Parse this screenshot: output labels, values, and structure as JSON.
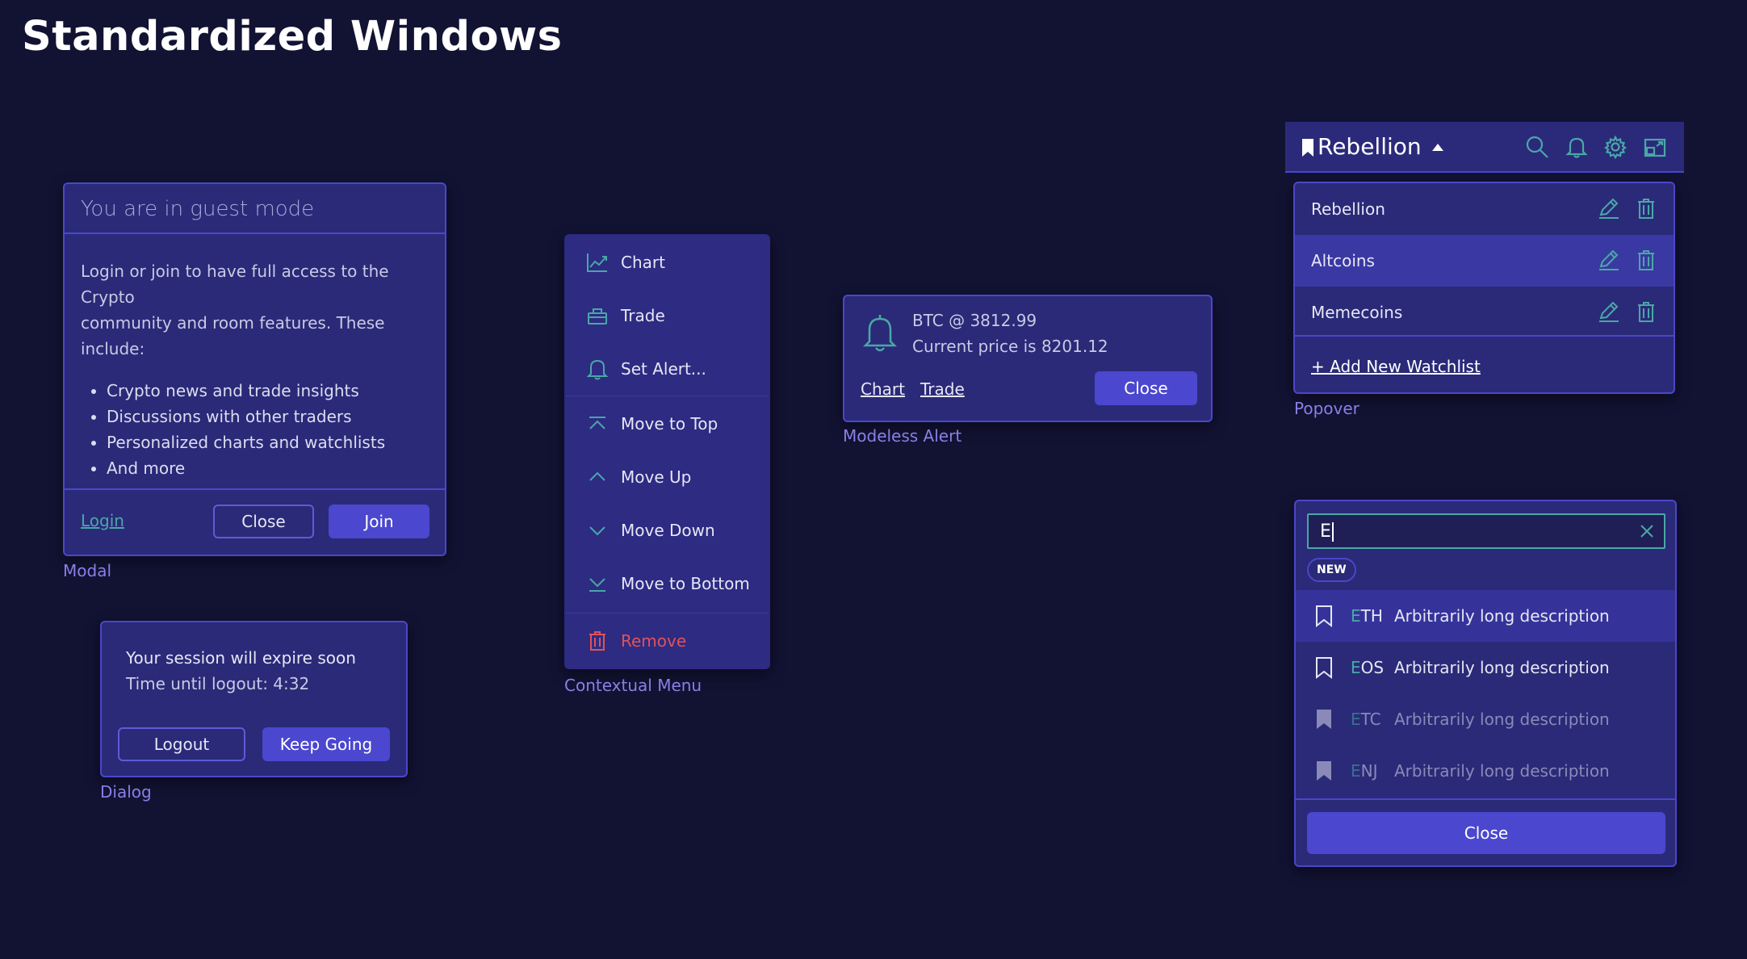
{
  "page": {
    "title": "Standardized Windows"
  },
  "captions": {
    "modal": "Modal",
    "dialog": "Dialog",
    "contextual_menu": "Contextual Menu",
    "modeless_alert": "Modeless Alert",
    "popover": "Popover"
  },
  "modal": {
    "title": "You are in guest mode",
    "body_lines": [
      "Login or join to have full access to the Crypto",
      "community and room features. These",
      "include:"
    ],
    "bullets": [
      "Crypto news and trade insights",
      "Discussions with other traders",
      "Personalized charts and watchlists",
      "And more"
    ],
    "login_link": "Login",
    "close_label": "Close",
    "join_label": "Join"
  },
  "dialog": {
    "title": "Your session will expire soon",
    "countdown": "Time until logout: 4:32",
    "logout_label": "Logout",
    "keep_going_label": "Keep Going"
  },
  "context_menu": {
    "items": [
      {
        "label": "Chart",
        "icon": "chart-icon"
      },
      {
        "label": "Trade",
        "icon": "basket-icon"
      },
      {
        "label": "Set Alert...",
        "icon": "bell-icon"
      },
      {
        "label": "Move to Top",
        "icon": "move-to-top-icon"
      },
      {
        "label": "Move Up",
        "icon": "chevron-up-icon"
      },
      {
        "label": "Move Down",
        "icon": "chevron-down-icon"
      },
      {
        "label": "Move to Bottom",
        "icon": "move-to-bottom-icon"
      },
      {
        "label": "Remove",
        "icon": "trash-icon"
      }
    ]
  },
  "modeless_alert": {
    "title": "BTC @ 3812.99",
    "subtitle": "Current price is 8201.12",
    "chart_link": "Chart",
    "trade_link": "Trade",
    "close_label": "Close"
  },
  "watchlist_header": {
    "selected": "Rebellion"
  },
  "popover": {
    "items": [
      {
        "label": "Rebellion",
        "selected": false
      },
      {
        "label": "Altcoins",
        "selected": true
      },
      {
        "label": "Memecoins",
        "selected": false
      }
    ],
    "add_link": "+ Add New Watchlist"
  },
  "search": {
    "query": "E",
    "badge": "NEW",
    "results": [
      {
        "match": "E",
        "rest": "TH",
        "description": "Arbitrarily long description",
        "bookmarked": false,
        "dimmed": false,
        "selected": true
      },
      {
        "match": "E",
        "rest": "OS",
        "description": "Arbitrarily long description",
        "bookmarked": false,
        "dimmed": false,
        "selected": false
      },
      {
        "match": "E",
        "rest": "TC",
        "description": "Arbitrarily long description",
        "bookmarked": true,
        "dimmed": true,
        "selected": false
      },
      {
        "match": "E",
        "rest": "NJ",
        "description": "Arbitrarily long description",
        "bookmarked": true,
        "dimmed": true,
        "selected": false
      }
    ],
    "close_label": "Close"
  },
  "colors": {
    "background": "#121233",
    "window": "#2a2a78",
    "border": "#4a47c9",
    "primary": "#4b47cf",
    "accent_teal": "#4aa7a6",
    "danger": "#e0525a",
    "caption": "#8a7fe6"
  }
}
